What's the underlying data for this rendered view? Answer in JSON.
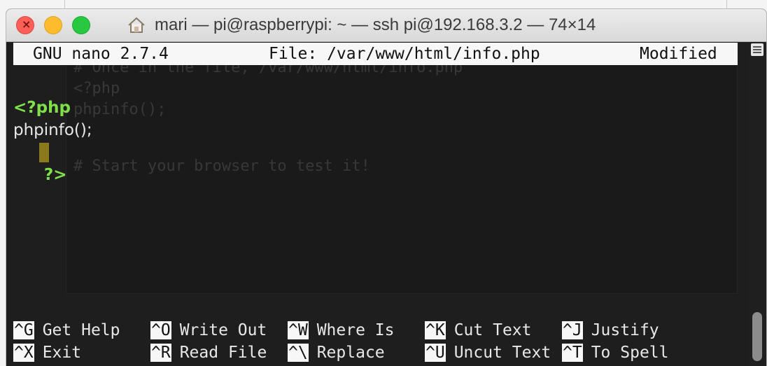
{
  "window": {
    "title": "mari — pi@raspberrypi: ~ — ssh pi@192.168.3.2 — 74×14",
    "title_icon": "home-icon"
  },
  "nano": {
    "version": "GNU nano 2.7.4",
    "file": "File: /var/www/html/info.php",
    "status": "Modified"
  },
  "editor": {
    "lines": [
      {
        "text": "<?php",
        "kind": "php-tag"
      },
      {
        "text": "phpinfo();",
        "kind": "plain"
      },
      {
        "text": "?>",
        "kind": "php-tag"
      }
    ]
  },
  "ghost": {
    "lines": [
      "# Once in the file, /var/www/html/info.php",
      "<?php",
      "phpinfo();",
      "",
      "# Start your browser to test it!"
    ]
  },
  "shortcuts": [
    {
      "key": "^G",
      "label": "Get Help"
    },
    {
      "key": "^O",
      "label": "Write Out"
    },
    {
      "key": "^W",
      "label": "Where Is"
    },
    {
      "key": "^K",
      "label": "Cut Text"
    },
    {
      "key": "^J",
      "label": "Justify"
    },
    {
      "key": "^X",
      "label": "Exit"
    },
    {
      "key": "^R",
      "label": "Read File"
    },
    {
      "key": "^\\",
      "label": "Replace"
    },
    {
      "key": "^U",
      "label": "Uncut Text"
    },
    {
      "key": "^T",
      "label": "To Spell"
    }
  ],
  "colors": {
    "terminal_bg": "#1e1e1e",
    "php_tag": "#7ee04a",
    "cursor": "#8b7a1c"
  }
}
